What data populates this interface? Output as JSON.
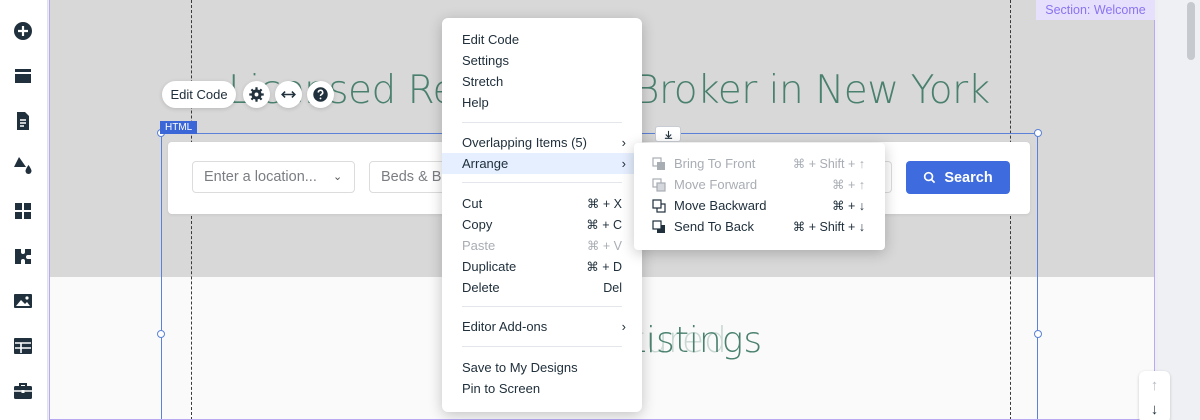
{
  "toolbar": {
    "items": [
      {
        "name": "add-elements",
        "icon": "plus-circle-icon"
      },
      {
        "name": "add-section",
        "icon": "sections-icon"
      },
      {
        "name": "pages",
        "icon": "page-icon"
      },
      {
        "name": "site-design",
        "icon": "paint-icon"
      },
      {
        "name": "apps",
        "icon": "apps-grid-icon"
      },
      {
        "name": "app-market",
        "icon": "puzzle-icon"
      },
      {
        "name": "media",
        "icon": "image-icon"
      },
      {
        "name": "cms",
        "icon": "table-icon"
      },
      {
        "name": "business",
        "icon": "briefcase-icon"
      }
    ]
  },
  "canvas": {
    "section_label": "Section: Welcome",
    "hero_title": "Licensed Real Estate Broker in New York",
    "featured_title": "Listings",
    "featured_ghost": "Featured"
  },
  "search_widget": {
    "location_placeholder": "Enter a location...",
    "beds_placeholder": "Beds & Baths",
    "search_label": "Search"
  },
  "element": {
    "tag": "HTML",
    "edit_code_label": "Edit Code"
  },
  "context_menu": {
    "items": [
      {
        "label": "Edit Code"
      },
      {
        "label": "Settings"
      },
      {
        "label": "Stretch"
      },
      {
        "label": "Help"
      },
      {
        "label": "Overlapping Items (5)",
        "submenu": true
      },
      {
        "label": "Arrange",
        "submenu": true,
        "active": true
      },
      {
        "label": "Cut",
        "shortcut": "⌘ + X"
      },
      {
        "label": "Copy",
        "shortcut": "⌘ + C"
      },
      {
        "label": "Paste",
        "shortcut": "⌘ + V",
        "disabled": true
      },
      {
        "label": "Duplicate",
        "shortcut": "⌘ + D"
      },
      {
        "label": "Delete",
        "shortcut": "Del"
      },
      {
        "label": "Editor Add-ons",
        "submenu": true
      },
      {
        "label": "Save to My Designs"
      },
      {
        "label": "Pin to Screen"
      }
    ]
  },
  "arrange_submenu": {
    "items": [
      {
        "label": "Bring To Front",
        "shortcut": "⌘ + Shift + ↑",
        "disabled": true
      },
      {
        "label": "Move Forward",
        "shortcut": "⌘ + ↑",
        "disabled": true
      },
      {
        "label": "Move Backward",
        "shortcut": "⌘ + ↓"
      },
      {
        "label": "Send To Back",
        "shortcut": "⌘ + Shift + ↓"
      }
    ]
  },
  "colors": {
    "accent": "#3e6bde",
    "heading_green": "#4a806e",
    "section_purple": "#8b73f0"
  }
}
